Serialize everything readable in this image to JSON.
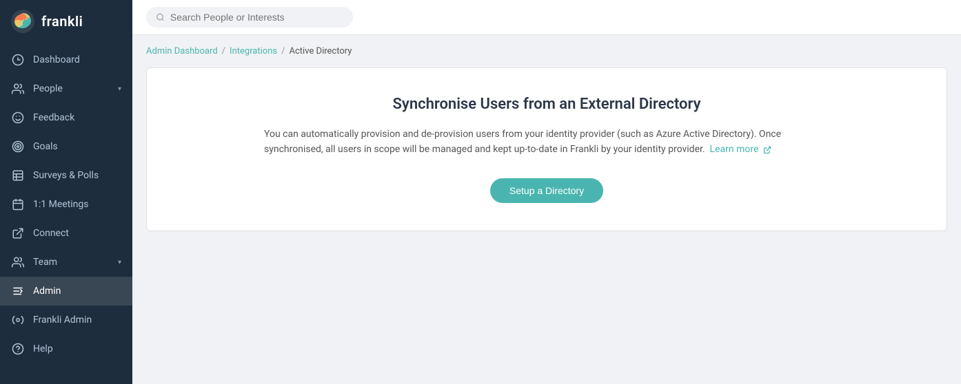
{
  "app": {
    "name": "frankli"
  },
  "search": {
    "placeholder": "Search People or Interests"
  },
  "breadcrumb": {
    "items": [
      {
        "label": "Admin Dashboard",
        "link": true
      },
      {
        "label": "Integrations",
        "link": true
      },
      {
        "label": "Active Directory",
        "link": false
      }
    ]
  },
  "card": {
    "title": "Synchronise Users from an External Directory",
    "description_part1": "You can automatically provision and de-provision users from your identity provider (such as Azure Active Directory). Once synchronised, all users in scope will be managed and kept up-to-date in Frankli by your identity provider.",
    "learn_more": "Learn more",
    "setup_button": "Setup a Directory"
  },
  "sidebar": {
    "items": [
      {
        "id": "dashboard",
        "label": "Dashboard",
        "icon": "dashboard-icon"
      },
      {
        "id": "people",
        "label": "People",
        "icon": "people-icon",
        "hasArrow": true
      },
      {
        "id": "feedback",
        "label": "Feedback",
        "icon": "feedback-icon"
      },
      {
        "id": "goals",
        "label": "Goals",
        "icon": "goals-icon"
      },
      {
        "id": "surveys",
        "label": "Surveys & Polls",
        "icon": "surveys-icon"
      },
      {
        "id": "meetings",
        "label": "1:1 Meetings",
        "icon": "meetings-icon"
      },
      {
        "id": "connect",
        "label": "Connect",
        "icon": "connect-icon"
      },
      {
        "id": "team",
        "label": "Team",
        "icon": "team-icon",
        "hasArrow": true
      },
      {
        "id": "admin",
        "label": "Admin",
        "icon": "admin-icon",
        "active": true
      },
      {
        "id": "frankli-admin",
        "label": "Frankli Admin",
        "icon": "frankli-admin-icon"
      },
      {
        "id": "help",
        "label": "Help",
        "icon": "help-icon"
      }
    ]
  }
}
